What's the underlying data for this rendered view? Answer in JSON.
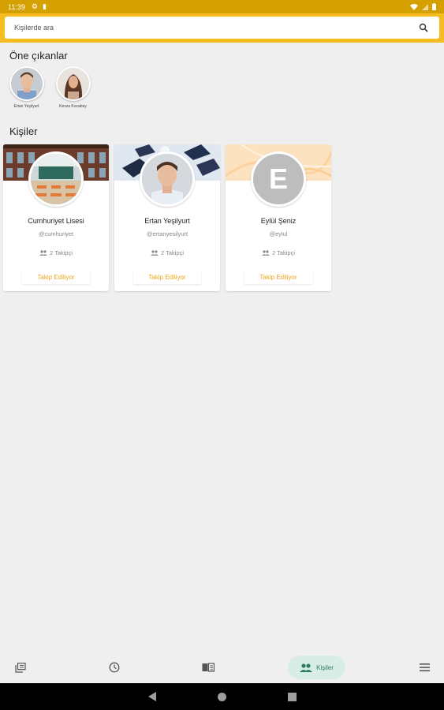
{
  "status_bar": {
    "time": "11:39",
    "icons": [
      "settings-icon",
      "sd-card-icon",
      "wifi-icon",
      "signal-icon",
      "battery-icon"
    ]
  },
  "search": {
    "placeholder": "Kişilerde ara",
    "icon": "search-icon"
  },
  "featured": {
    "title": "Öne çıkanlar",
    "items": [
      {
        "name": "Ertan Yeşilyurt",
        "icon": "male-avatar-photo"
      },
      {
        "name": "Kevza Kocabey",
        "icon": "female-avatar-photo"
      }
    ]
  },
  "people": {
    "title": "Kişiler",
    "cards": [
      {
        "name": "Cumhuriyet Lisesi",
        "handle": "@cumhuriyet",
        "followers": "2 Takipçi",
        "button": "Takip Ediliyor",
        "cover": "school-building-photo",
        "avatar": "classroom-photo"
      },
      {
        "name": "Ertan Yeşilyurt",
        "handle": "@ertanyesilyurt",
        "followers": "2 Takipçi",
        "button": "Takip Ediliyor",
        "cover": "graduation-caps-photo",
        "avatar": "male-avatar-photo"
      },
      {
        "name": "Eylül Şeniz",
        "handle": "@eylul",
        "followers": "2 Takipçi",
        "button": "Takip Ediliyor",
        "cover": "peach-pattern",
        "avatar_letter": "E"
      }
    ]
  },
  "bottom_nav": {
    "items": [
      {
        "icon": "library-icon"
      },
      {
        "icon": "history-icon"
      },
      {
        "icon": "book-open-icon"
      },
      {
        "icon": "people-icon",
        "label": "Kişiler",
        "active": true
      },
      {
        "icon": "menu-icon"
      }
    ]
  },
  "colors": {
    "accent": "#f5bd1f",
    "status_bar": "#d4a100",
    "follow_text": "#f0a61d",
    "nav_active_bg": "#d9ede7",
    "nav_active_text": "#2f7a64",
    "background": "#efefef"
  }
}
